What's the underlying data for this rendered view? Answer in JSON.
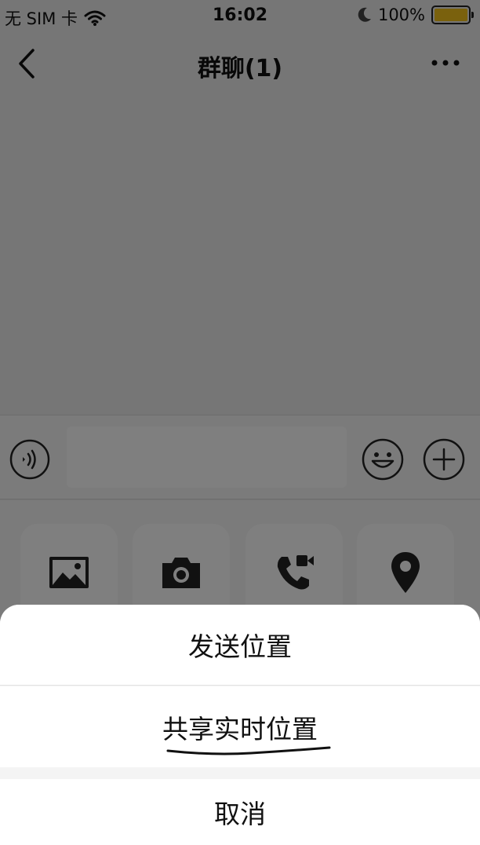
{
  "status_bar": {
    "carrier": "无 SIM 卡",
    "time": "16:02",
    "battery": "100%",
    "battery_level": 1.0,
    "icons": [
      "wifi-icon",
      "moon-icon",
      "battery-icon"
    ]
  },
  "nav": {
    "title": "群聊(1)",
    "icons": [
      "back-chevron-icon",
      "more-dots-icon"
    ]
  },
  "input_bar": {
    "message_value": "",
    "icons": [
      "voice-icon",
      "emoji-icon",
      "plus-icon"
    ]
  },
  "tools": {
    "items": [
      {
        "icon": "image-icon"
      },
      {
        "icon": "camera-icon"
      },
      {
        "icon": "video-call-icon"
      },
      {
        "icon": "location-pin-icon"
      }
    ]
  },
  "action_sheet": {
    "send_location": "发送位置",
    "share_live_location": "共享实时位置",
    "cancel": "取消"
  },
  "colors": {
    "battery_fill": "#f4c21a",
    "overlay": "rgba(0,0,0,0.5)",
    "sheet_background": "#ffffff"
  }
}
